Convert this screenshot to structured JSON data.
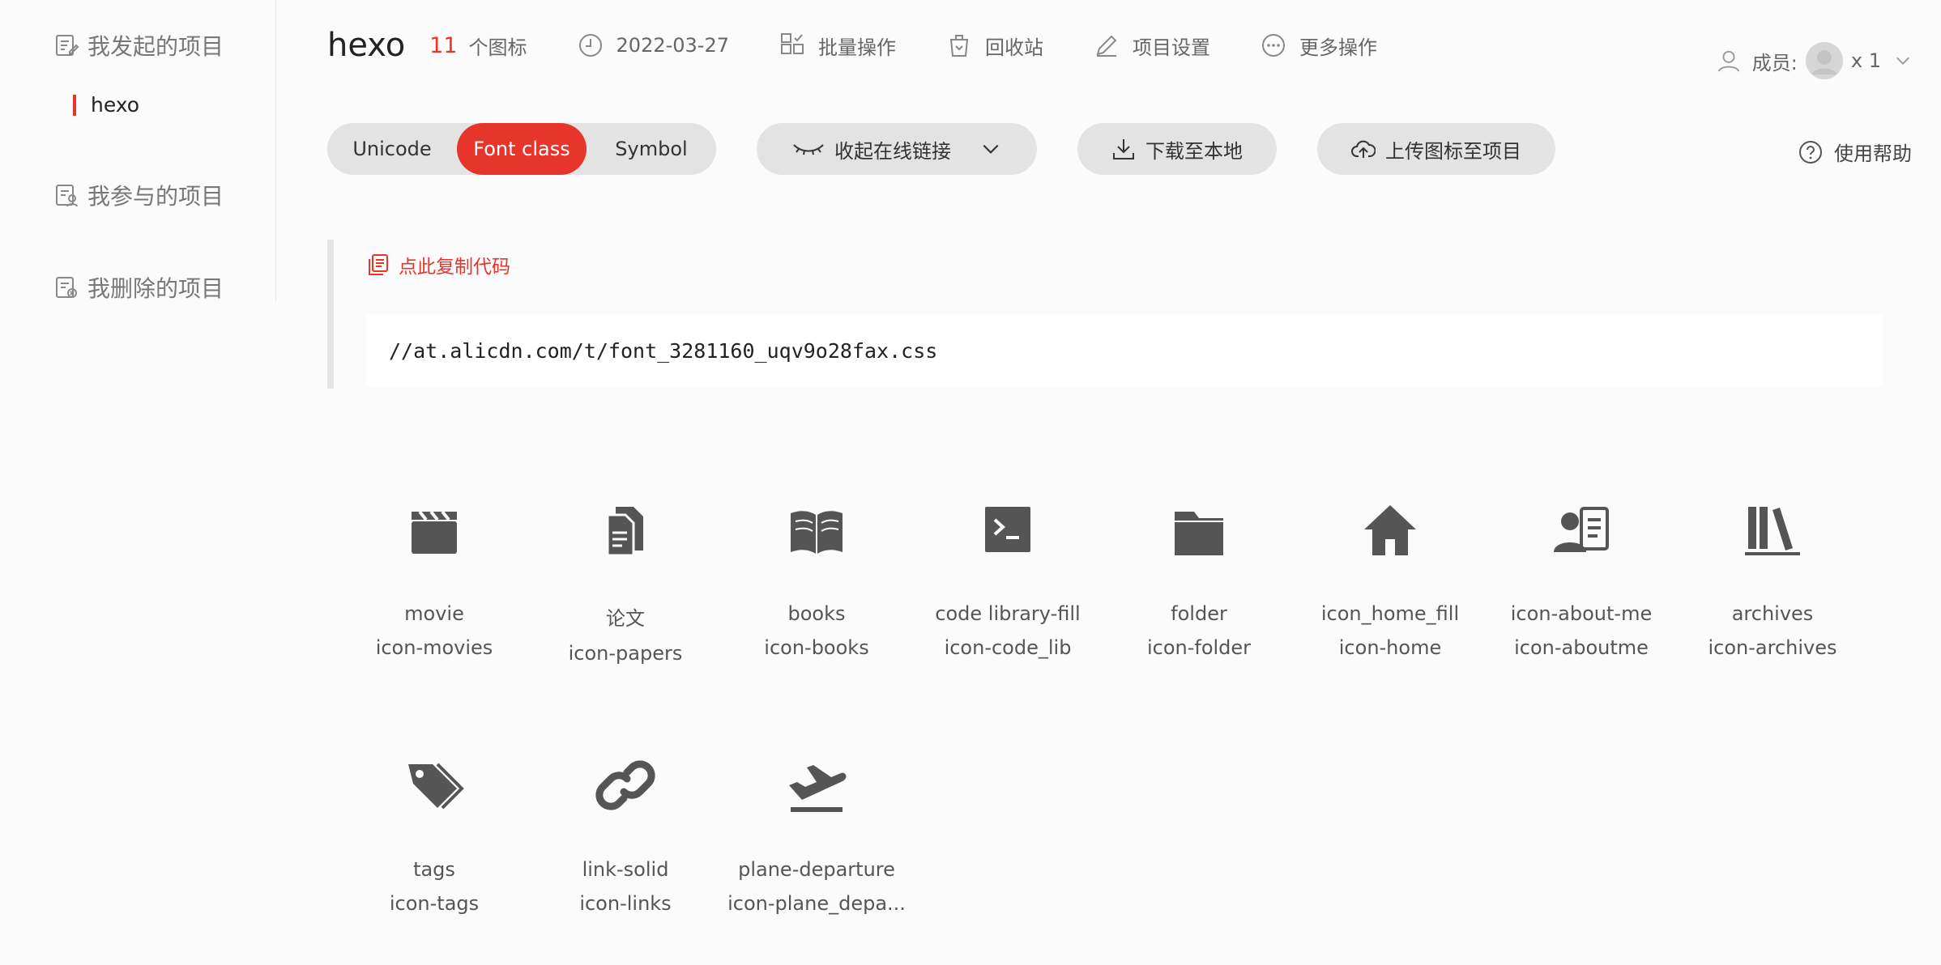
{
  "sidebar": {
    "created": "我发起的项目",
    "project": "hexo",
    "joined": "我参与的项目",
    "deleted": "我删除的项目"
  },
  "header": {
    "project_name": "hexo",
    "icon_count": "11",
    "icon_count_label": "个图标",
    "date": "2022-03-27",
    "batch": "批量操作",
    "recycle": "回收站",
    "settings": "项目设置",
    "more": "更多操作",
    "members_label": "成员:",
    "members_count": "x 1"
  },
  "toolbar": {
    "tabs": [
      "Unicode",
      "Font class",
      "Symbol"
    ],
    "active_tab": "Font class",
    "collapse": "收起在线链接",
    "download": "下载至本地",
    "upload": "上传图标至项目",
    "help": "使用帮助"
  },
  "code": {
    "copy": "点此复制代码",
    "url": "//at.alicdn.com/t/font_3281160_uqv9o28fax.css"
  },
  "icons": [
    {
      "name": "movie",
      "class": "icon-movies",
      "icon": "movie-icon"
    },
    {
      "name": "论文",
      "class": "icon-papers",
      "icon": "papers-icon"
    },
    {
      "name": "books",
      "class": "icon-books",
      "icon": "books-icon"
    },
    {
      "name": "code library-fill",
      "class": "icon-code_lib",
      "icon": "code-library-icon"
    },
    {
      "name": "folder",
      "class": "icon-folder",
      "icon": "folder-icon"
    },
    {
      "name": "icon_home_fill",
      "class": "icon-home",
      "icon": "home-icon"
    },
    {
      "name": "icon-about-me",
      "class": "icon-aboutme",
      "icon": "about-me-icon"
    },
    {
      "name": "archives",
      "class": "icon-archives",
      "icon": "archives-icon"
    },
    {
      "name": "tags",
      "class": "icon-tags",
      "icon": "tags-icon"
    },
    {
      "name": "link-solid",
      "class": "icon-links",
      "icon": "link-icon"
    },
    {
      "name": "plane-departure",
      "class": "icon-plane_depa...",
      "icon": "plane-departure-icon"
    }
  ],
  "colors": {
    "accent": "#e8352b",
    "icon": "#555555"
  }
}
